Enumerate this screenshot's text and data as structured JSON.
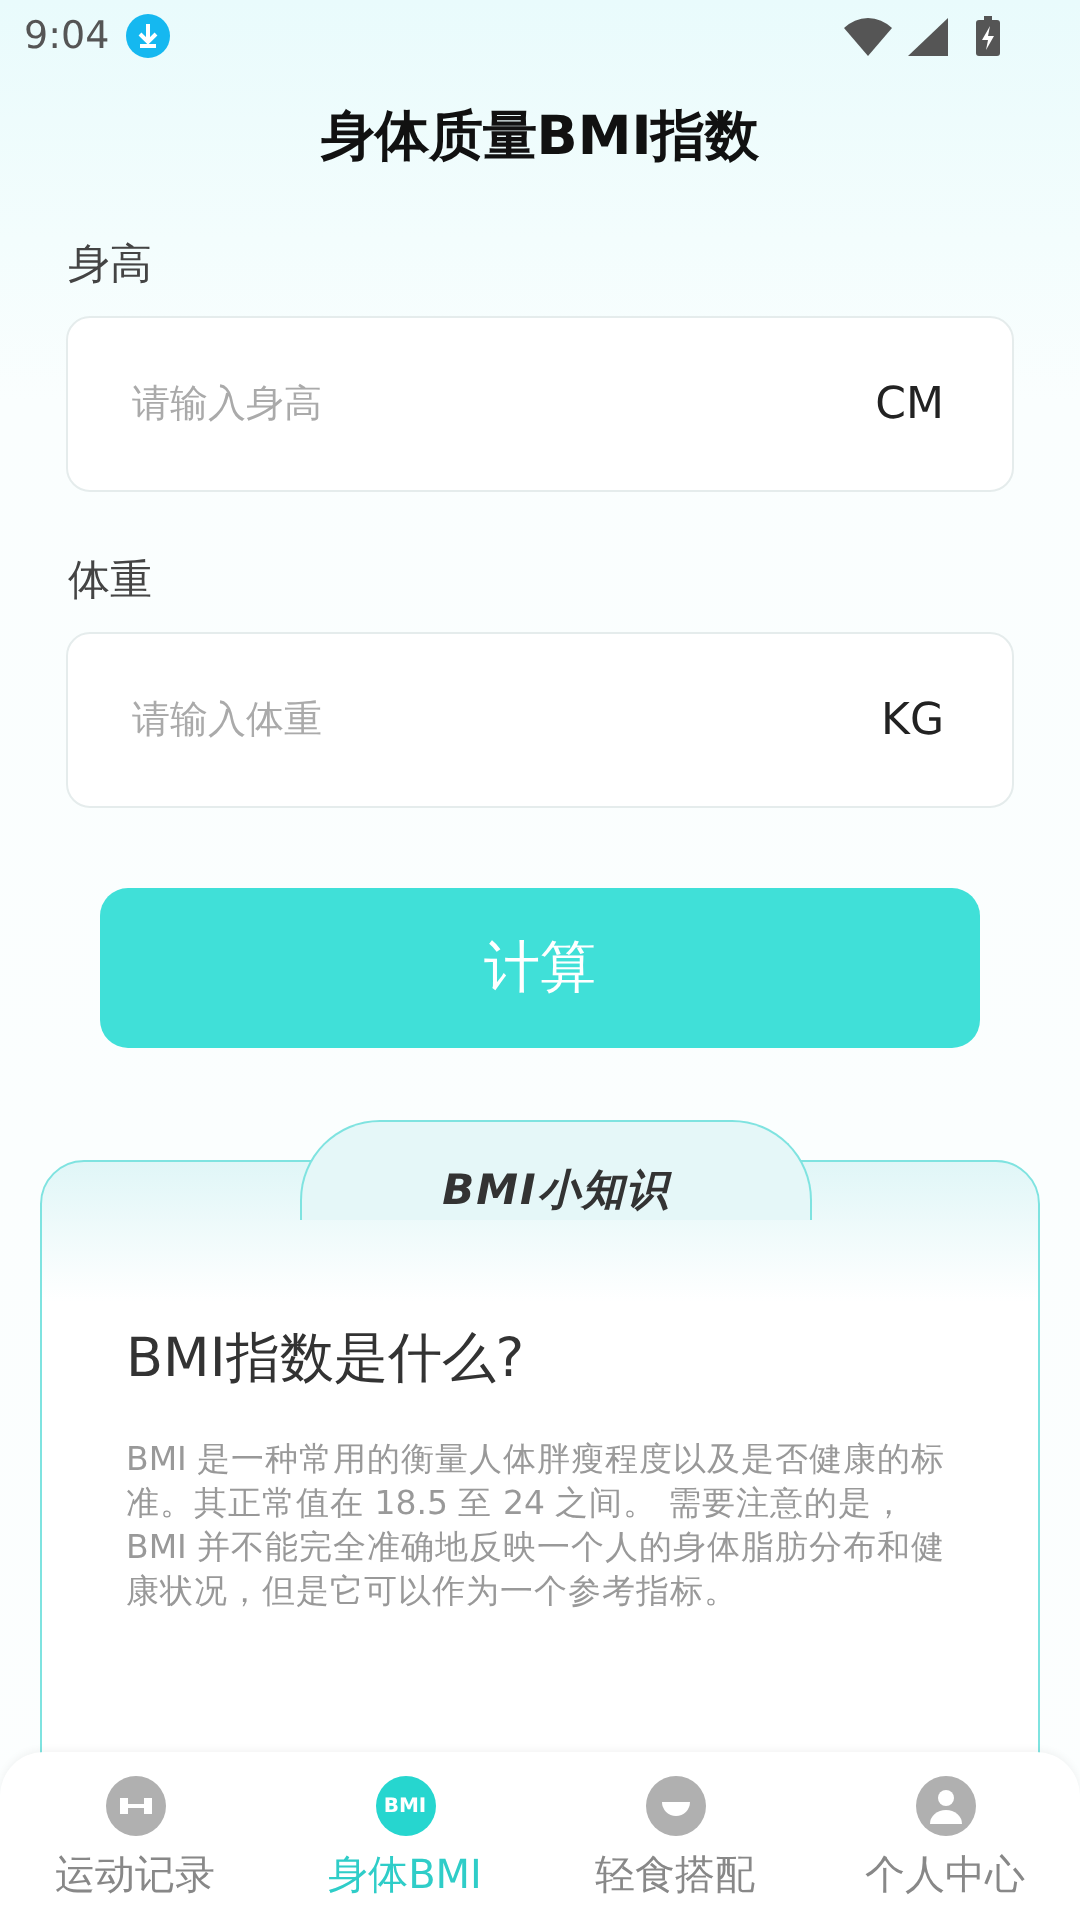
{
  "status_bar": {
    "time": "9:04"
  },
  "title": "身体质量BMI指数",
  "fields": [
    {
      "label": "身高",
      "placeholder": "请输入身高",
      "unit": "CM"
    },
    {
      "label": "体重",
      "placeholder": "请输入体重",
      "unit": "KG"
    }
  ],
  "calculate_button": "计算",
  "knowledge_card": {
    "header": "BMI小知识",
    "heading": "BMI指数是什么?",
    "body": "BMI 是一种常用的衡量人体胖瘦程度以及是否健康的标准。其正常值在 18.5 至 24 之间。 需要注意的是，BMI 并不能完全准确地反映一个人的身体脂肪分布和健康状况，但是它可以作为一个参考指标。"
  },
  "bottom_nav": [
    {
      "kind": "dumbbell",
      "label": "运动记录",
      "selected": false
    },
    {
      "kind": "bmi",
      "icon_text": "BMI",
      "label": "身体BMI",
      "selected": true
    },
    {
      "kind": "food",
      "label": "轻食搭配",
      "selected": false
    },
    {
      "kind": "person",
      "label": "个人中心",
      "selected": false
    }
  ]
}
